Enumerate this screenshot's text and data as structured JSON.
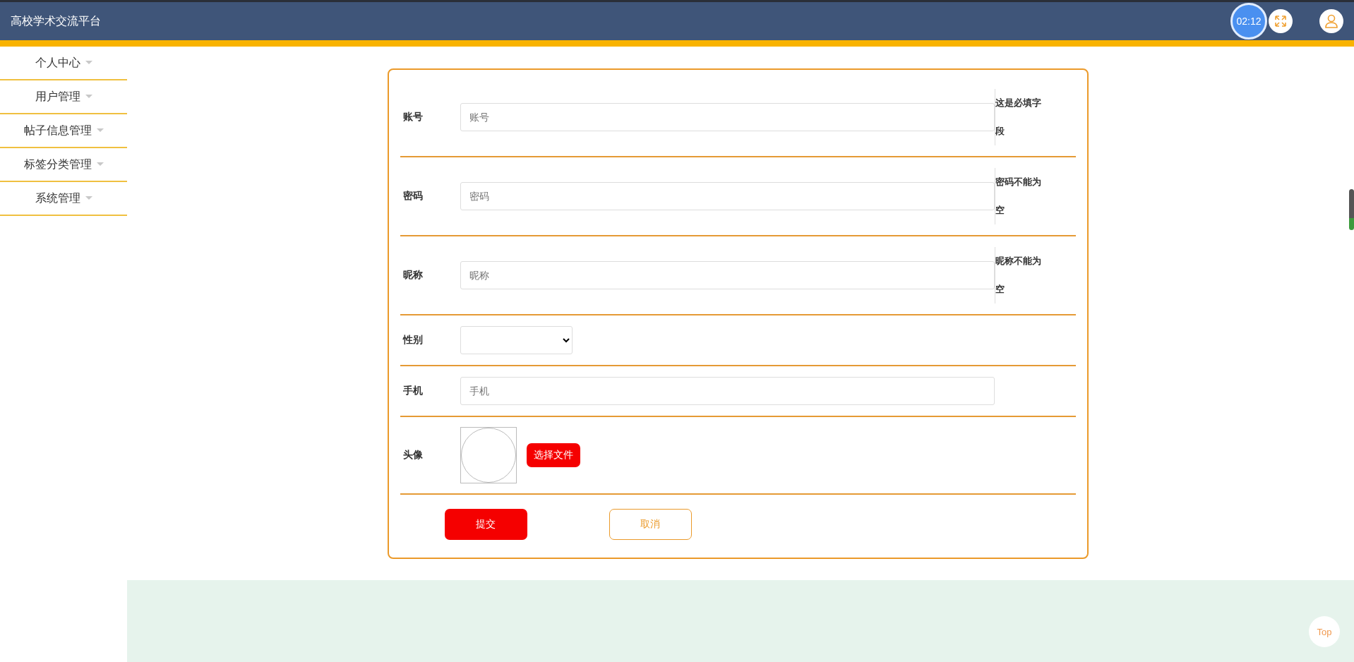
{
  "header": {
    "title": "高校学术交流平台",
    "timer": "02:12"
  },
  "sidebar": {
    "items": [
      {
        "label": "个人中心"
      },
      {
        "label": "用户管理"
      },
      {
        "label": "帖子信息管理"
      },
      {
        "label": "标签分类管理"
      },
      {
        "label": "系统管理"
      }
    ]
  },
  "form": {
    "fields": [
      {
        "kind": "text",
        "label": "账号",
        "placeholder": "账号",
        "error": "这是必填字段"
      },
      {
        "kind": "text",
        "label": "密码",
        "placeholder": "密码",
        "error": "密码不能为空"
      },
      {
        "kind": "text",
        "label": "昵称",
        "placeholder": "昵称",
        "error": "昵称不能为空"
      },
      {
        "kind": "select",
        "label": "性别"
      },
      {
        "kind": "text",
        "label": "手机",
        "placeholder": "手机"
      },
      {
        "kind": "file",
        "label": "头像",
        "button": "选择文件"
      }
    ],
    "submit": "提交",
    "cancel": "取消"
  },
  "back_to_top": "Top"
}
